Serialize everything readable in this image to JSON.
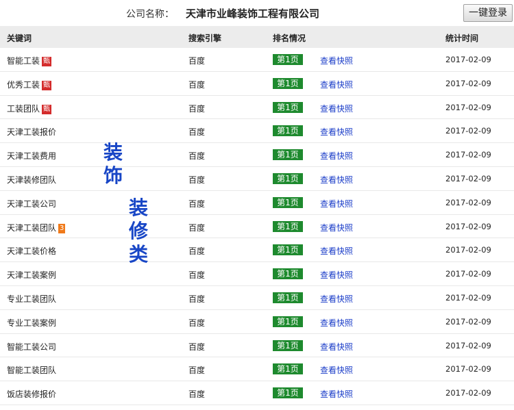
{
  "header": {
    "company_label": "公司名称：",
    "company_name": "天津市业峰装饰工程有限公司",
    "login_button": "一键登录"
  },
  "columns": {
    "keyword": "关键词",
    "engine": "搜索引擎",
    "rank": "排名情况",
    "date": "统计时间"
  },
  "rows": [
    {
      "keyword": "智能工装",
      "badge": "甄",
      "engine": "百度",
      "rank": "第1页",
      "snapshot": "查看快照",
      "date": "2017-02-09"
    },
    {
      "keyword": "优秀工装",
      "badge": "甄",
      "engine": "百度",
      "rank": "第1页",
      "snapshot": "查看快照",
      "date": "2017-02-09"
    },
    {
      "keyword": "工装团队",
      "badge": "甄",
      "engine": "百度",
      "rank": "第1页",
      "snapshot": "查看快照",
      "date": "2017-02-09"
    },
    {
      "keyword": "天津工装报价",
      "engine": "百度",
      "rank": "第1页",
      "snapshot": "查看快照",
      "date": "2017-02-09"
    },
    {
      "keyword": "天津工装费用",
      "engine": "百度",
      "rank": "第1页",
      "snapshot": "查看快照",
      "date": "2017-02-09"
    },
    {
      "keyword": "天津装修团队",
      "engine": "百度",
      "rank": "第1页",
      "snapshot": "查看快照",
      "date": "2017-02-09"
    },
    {
      "keyword": "天津工装公司",
      "engine": "百度",
      "rank": "第1页",
      "snapshot": "查看快照",
      "date": "2017-02-09"
    },
    {
      "keyword": "天津工装团队",
      "badge": "3",
      "engine": "百度",
      "rank": "第1页",
      "snapshot": "查看快照",
      "date": "2017-02-09"
    },
    {
      "keyword": "天津工装价格",
      "engine": "百度",
      "rank": "第1页",
      "snapshot": "查看快照",
      "date": "2017-02-09"
    },
    {
      "keyword": "天津工装案例",
      "engine": "百度",
      "rank": "第1页",
      "snapshot": "查看快照",
      "date": "2017-02-09"
    },
    {
      "keyword": "专业工装团队",
      "engine": "百度",
      "rank": "第1页",
      "snapshot": "查看快照",
      "date": "2017-02-09"
    },
    {
      "keyword": "专业工装案例",
      "engine": "百度",
      "rank": "第1页",
      "snapshot": "查看快照",
      "date": "2017-02-09"
    },
    {
      "keyword": "智能工装公司",
      "engine": "百度",
      "rank": "第1页",
      "snapshot": "查看快照",
      "date": "2017-02-09"
    },
    {
      "keyword": "智能工装团队",
      "engine": "百度",
      "rank": "第1页",
      "snapshot": "查看快照",
      "date": "2017-02-09"
    },
    {
      "keyword": "饭店装修报价",
      "engine": "百度",
      "rank": "第1页",
      "snapshot": "查看快照",
      "date": "2017-02-09"
    }
  ],
  "overlay": {
    "chars_a": [
      "装",
      "饰"
    ],
    "chars_b": [
      "装",
      "修",
      "类"
    ]
  },
  "colors": {
    "rank_badge": "#1e8a2e",
    "link": "#1a3cc8",
    "overlay_text": "#1846c6",
    "badge_red": "#d42c2c",
    "badge_orange": "#f07a1a"
  }
}
